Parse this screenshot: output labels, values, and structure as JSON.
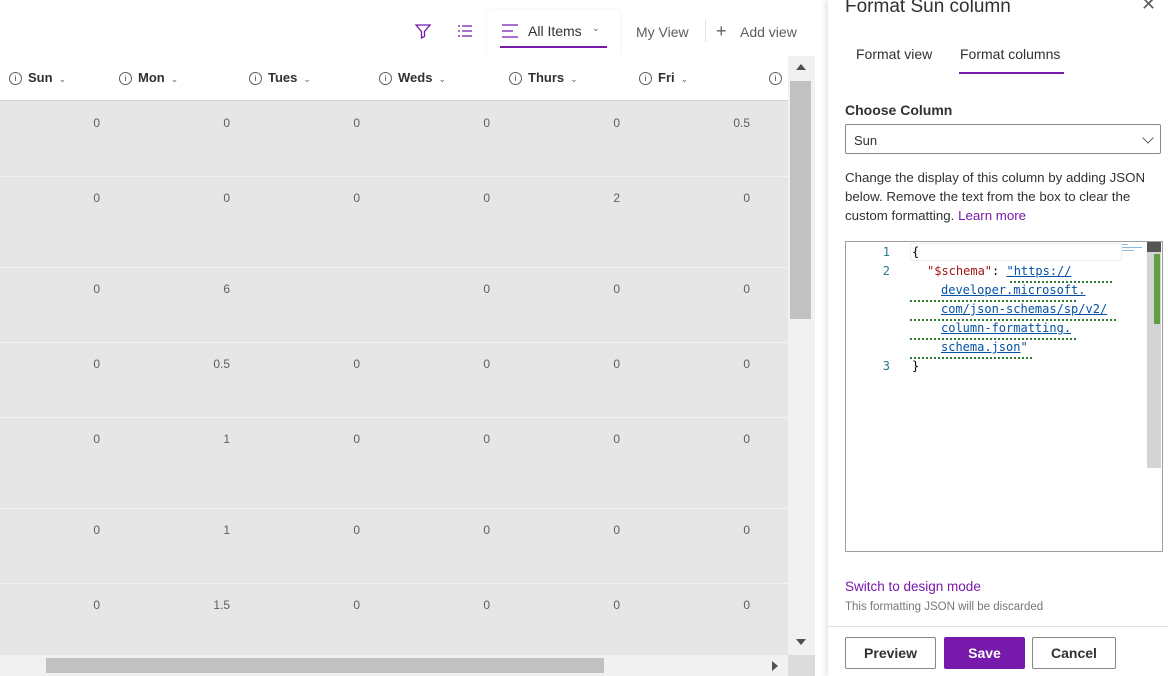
{
  "commandbar": {
    "views": {
      "all_items": "All Items",
      "my_view": "My View",
      "add_view": "Add view"
    }
  },
  "columns": [
    "Sun",
    "Mon",
    "Tues",
    "Weds",
    "Thurs",
    "Fri",
    ""
  ],
  "rows": [
    [
      "0",
      "0",
      "0",
      "0",
      "0",
      "0.5"
    ],
    [
      "0",
      "0",
      "0",
      "0",
      "2",
      "0"
    ],
    [
      "0",
      "6",
      "",
      "0",
      "0",
      "0"
    ],
    [
      "0",
      "0.5",
      "0",
      "0",
      "0",
      "0"
    ],
    [
      "0",
      "1",
      "0",
      "0",
      "0",
      "0"
    ],
    [
      "0",
      "1",
      "0",
      "0",
      "0",
      "0"
    ],
    [
      "0",
      "1.5",
      "0",
      "0",
      "0",
      "0"
    ]
  ],
  "panel": {
    "title": "Format Sun column",
    "tabs": {
      "format_view": "Format view",
      "format_columns": "Format columns"
    },
    "choose_label": "Choose Column",
    "selected_column": "Sun",
    "description": "Change the display of this column by adding JSON below. Remove the text from the box to clear the custom formatting.",
    "learn_more": "Learn more",
    "editor": {
      "line_numbers": [
        "1",
        "2",
        "3"
      ],
      "open_brace": "{",
      "schema_key": "\"$schema\"",
      "colon": ": ",
      "schema_url_lines": [
        "\"https://",
        "developer.microsoft.",
        "com/json-schemas/sp/v2/",
        "column-formatting.",
        "schema.json"
      ],
      "closing_quote": "\"",
      "close_brace": "}"
    },
    "switch_mode": "Switch to design mode",
    "discard_note": "This formatting JSON will be discarded",
    "buttons": {
      "preview": "Preview",
      "save": "Save",
      "cancel": "Cancel"
    }
  },
  "colors": {
    "accent": "#7719aa",
    "row_bg": "#e6e6e6"
  }
}
